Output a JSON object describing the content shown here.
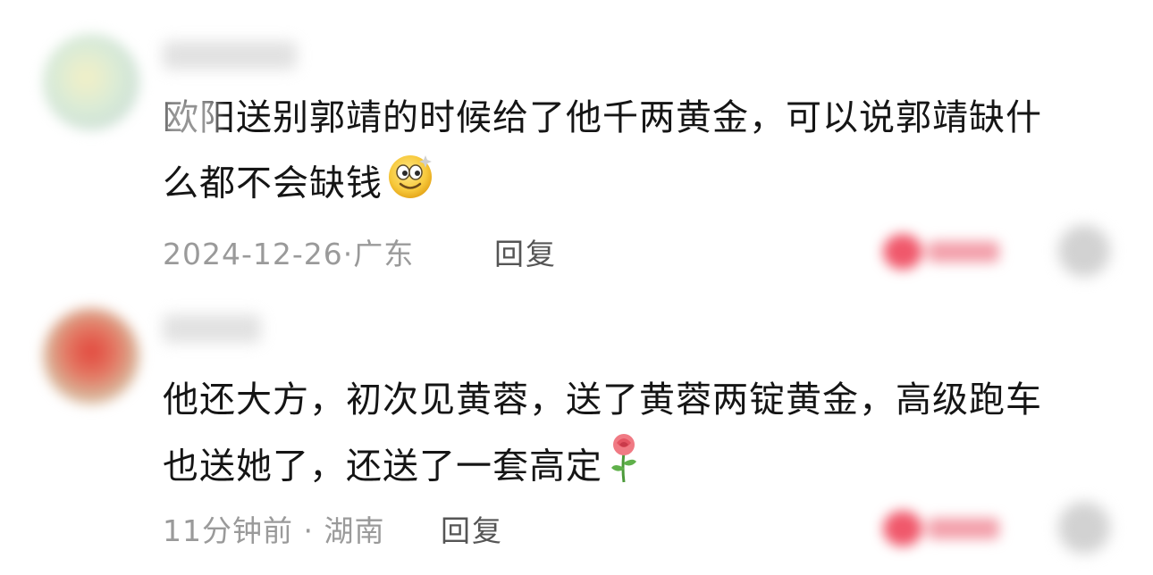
{
  "comments": [
    {
      "text_line1": "欧阳送别郭靖的时候给了他千两黄金，可以说郭靖缺什",
      "text_line2": "么都不会缺钱",
      "emoji": "smile-emoji",
      "meta": "2024-12-26·广东",
      "reply_label": "回复"
    },
    {
      "text_line1": "他还大方，初次见黄蓉，送了黄蓉两锭黄金，高级跑车",
      "text_line2": "也送她了，还送了一套高定",
      "emoji": "rose-emoji",
      "meta": "11分钟前 · 湖南",
      "reply_label": "回复"
    }
  ],
  "colors": {
    "like": "#f0586b",
    "meta": "#9a9a9a",
    "reply": "#555555",
    "text": "#151515"
  }
}
